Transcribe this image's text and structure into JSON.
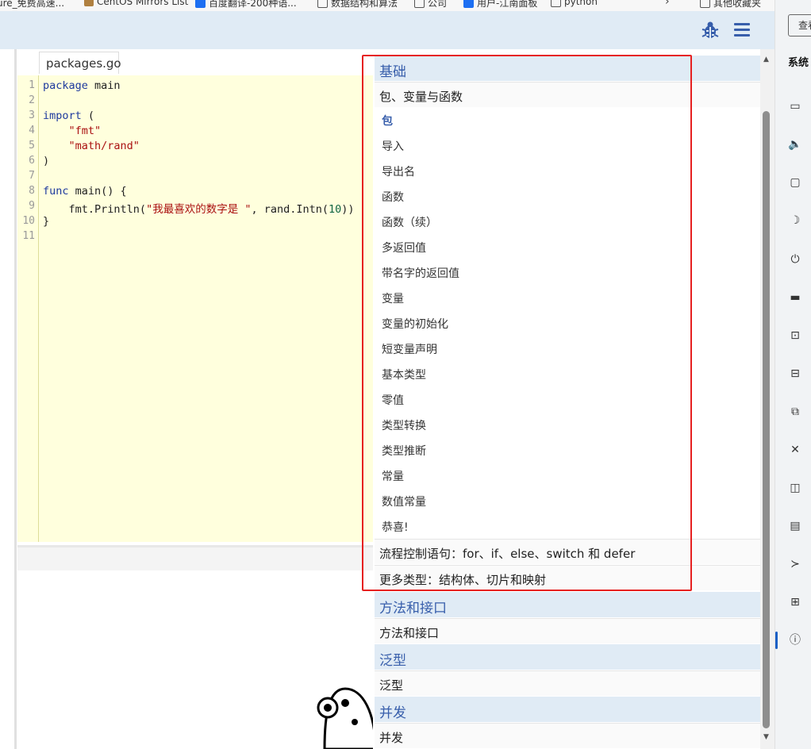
{
  "bookmarks": [
    {
      "label": "ure_免费高速...",
      "icon": "folder-icon"
    },
    {
      "label": "CentOS Mirrors List",
      "icon": "favicon-icon"
    },
    {
      "label": "百度翻译-200种语...",
      "icon": "translate-icon"
    },
    {
      "label": "数据结构和算法",
      "icon": "folder-icon"
    },
    {
      "label": "公司",
      "icon": "folder-icon"
    },
    {
      "label": "用户-江南面板",
      "icon": "favicon-icon"
    },
    {
      "label": "python",
      "icon": "folder-icon"
    },
    {
      "label": "其他收藏夹",
      "icon": "folder-icon"
    }
  ],
  "header": {
    "bug_icon": "bug-icon",
    "menu_icon": "hamburger-menu-icon",
    "accent": "#375eab",
    "bg": "#e0ebf5"
  },
  "editor": {
    "file_tab": "packages.go",
    "line_numbers": [
      "1",
      "2",
      "3",
      "4",
      "5",
      "6",
      "7",
      "8",
      "9",
      "10",
      "11"
    ],
    "code": {
      "l1_kw": "package",
      "l1_rest": " main",
      "l3_kw": "import",
      "l3_rest": " (",
      "l4_str": "\"fmt\"",
      "l5_str": "\"math/rand\"",
      "l6": ")",
      "l8_kw": "func",
      "l8_rest": " main() {",
      "l9_a": "fmt.Println(",
      "l9_str": "\"我最喜欢的数字是 \"",
      "l9_b": ", rand.Intn(",
      "l9_num": "10",
      "l9_c": "))",
      "l10": "}"
    }
  },
  "toc": {
    "sections": [
      {
        "title": "基础"
      },
      {
        "title": "方法和接口"
      },
      {
        "title": "泛型"
      },
      {
        "title": "并发"
      }
    ],
    "lessons": {
      "basics_1": "包、变量与函数",
      "basics_2": "流程控制语句：for、if、else、switch 和 defer",
      "basics_3": "更多类型：结构体、切片和映射",
      "methods_1": "方法和接口",
      "generics_1": "泛型",
      "concurrency_1": "并发"
    },
    "pages": [
      "包",
      "导入",
      "导出名",
      "函数",
      "函数（续）",
      "多返回值",
      "带名字的返回值",
      "变量",
      "变量的初始化",
      "短变量声明",
      "基本类型",
      "零值",
      "类型转换",
      "类型推断",
      "常量",
      "数值常量",
      "恭喜!"
    ],
    "active_page": "包"
  },
  "sidepanel": {
    "search_label": "查看",
    "title": "系统",
    "icons": [
      "monitor-icon",
      "speaker-icon",
      "chat-icon",
      "moon-icon",
      "power-icon",
      "battery-icon",
      "touch-icon",
      "screen-icon",
      "multitask-icon",
      "network-icon",
      "tablet-icon",
      "clipboard-icon",
      "remote-icon",
      "apps-icon",
      "info-icon"
    ]
  },
  "annotation": {
    "color": "#e62020"
  }
}
